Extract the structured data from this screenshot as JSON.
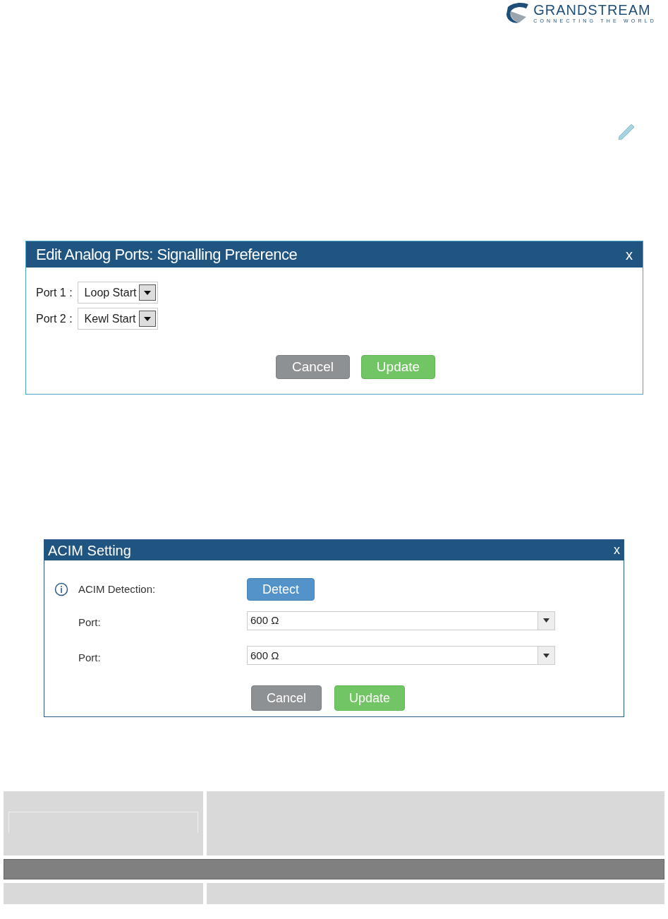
{
  "logo": {
    "name": "GRANDSTREAM",
    "tagline": "CONNECTING THE WORLD"
  },
  "signalling_dialog": {
    "title": "Edit Analog Ports: Signalling Preference",
    "close": "x",
    "ports": [
      {
        "label": "Port 1 :",
        "value": "Loop Start"
      },
      {
        "label": "Port 2 :",
        "value": "Kewl Start"
      }
    ],
    "buttons": [
      {
        "label": "Cancel",
        "kind": "cancel"
      },
      {
        "label": "Update",
        "kind": "update"
      }
    ]
  },
  "acim_dialog": {
    "title": "ACIM Setting",
    "close": "x",
    "detection_label": "ACIM Detection:",
    "detect_button": "Detect",
    "ports": [
      {
        "label": "Port:",
        "value": "600 Ω"
      },
      {
        "label": "Port:",
        "value": "600 Ω"
      }
    ],
    "buttons": [
      {
        "label": "Cancel",
        "kind": "cancel"
      },
      {
        "label": "Update",
        "kind": "update"
      }
    ]
  }
}
